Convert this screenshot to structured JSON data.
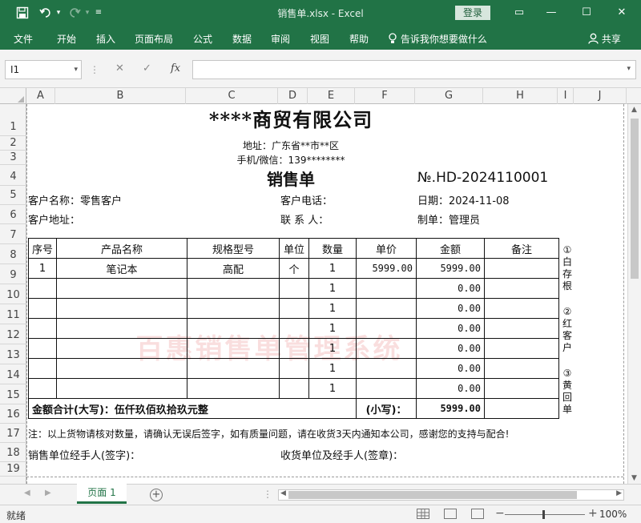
{
  "titlebar": {
    "title": "销售单.xlsx - Excel",
    "login": "登录",
    "save_icon": "save-icon",
    "undo_icon": "undo-icon",
    "redo_icon": "redo-icon",
    "customize_icon": "customize-qat-icon"
  },
  "menu": {
    "items": [
      "文件",
      "开始",
      "插入",
      "页面布局",
      "公式",
      "数据",
      "审阅",
      "视图",
      "帮助"
    ],
    "tell_me": "告诉我你想要做什么",
    "share": "共享"
  },
  "formula_bar": {
    "name_box": "I1",
    "fx": "fx",
    "cancel": "✕",
    "enter": "✓",
    "value": ""
  },
  "grid": {
    "columns": [
      "A",
      "B",
      "C",
      "D",
      "E",
      "F",
      "G",
      "H",
      "I",
      "J"
    ],
    "rows": [
      "1",
      "2",
      "3",
      "4",
      "5",
      "6",
      "7",
      "8",
      "9",
      "10",
      "11",
      "12",
      "13",
      "14",
      "15",
      "16",
      "17",
      "18",
      "19"
    ]
  },
  "sheet": {
    "company": "****商贸有限公司",
    "address": "地址：广东省**市**区",
    "phone": "手机/微信：139********",
    "doc_title": "销售单",
    "doc_no": "№.HD-2024110001",
    "customer_name": "客户名称：零售客户",
    "customer_phone": "客户电话：",
    "date": "日期：2024-11-08",
    "customer_addr": "客户地址：",
    "contact": "联 系 人：",
    "maker": "制单：管理员",
    "headers": [
      "序号",
      "产品名称",
      "规格型号",
      "单位",
      "数量",
      "单价",
      "金额",
      "备注"
    ],
    "rows": [
      [
        "1",
        "笔记本",
        "高配",
        "个",
        "1",
        "5999.00",
        "5999.00",
        ""
      ],
      [
        "",
        "",
        "",
        "",
        "1",
        "",
        "0.00",
        ""
      ],
      [
        "",
        "",
        "",
        "",
        "1",
        "",
        "0.00",
        ""
      ],
      [
        "",
        "",
        "",
        "",
        "1",
        "",
        "0.00",
        ""
      ],
      [
        "",
        "",
        "",
        "",
        "1",
        "",
        "0.00",
        ""
      ],
      [
        "",
        "",
        "",
        "",
        "1",
        "",
        "0.00",
        ""
      ],
      [
        "",
        "",
        "",
        "",
        "1",
        "",
        "0.00",
        ""
      ]
    ],
    "total_label": "金额合计(大写)：伍仟玖佰玖拾玖元整",
    "total_small_label": "(小写)：",
    "total_value": "5999.00",
    "note": "注：以上货物请核对数量，请确认无误后签字，如有质量问题，请在收货3天内通知本公司，感谢您的支持与配合!",
    "sign_seller": "销售单位经手人(签字)：",
    "sign_receiver": "收货单位及经手人(签章)：",
    "copy_notes": [
      "①白存根",
      "②红客户",
      "③黄回单"
    ],
    "watermark": "百惠销售单管理系统"
  },
  "sheet_tabs": {
    "tabs": [
      "页面 1"
    ],
    "add_icon": "add-sheet-icon"
  },
  "status": {
    "ready": "就绪",
    "zoom": "100%"
  }
}
